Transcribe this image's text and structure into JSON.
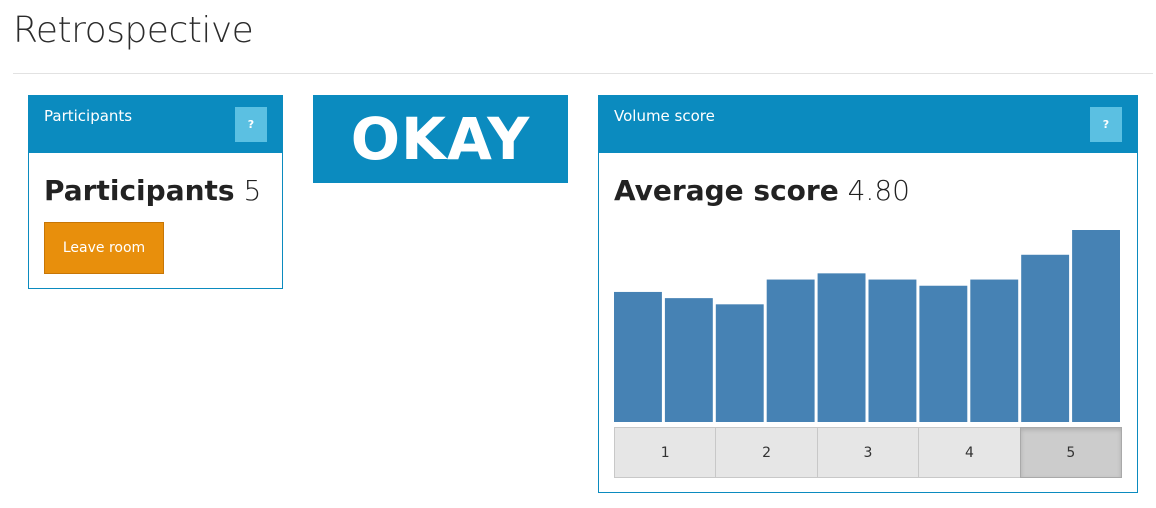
{
  "page": {
    "title": "Retrospective"
  },
  "participants_panel": {
    "title": "Participants",
    "help_label": "?",
    "count_label": "Participants",
    "count_value": "5",
    "leave_button": "Leave room"
  },
  "status_banner": "OKAY",
  "volume_panel": {
    "title": "Volume score",
    "help_label": "?",
    "average_label": "Average score",
    "average_value": "4.80",
    "score_buttons": [
      "1",
      "2",
      "3",
      "4",
      "5"
    ],
    "selected_score": "5"
  },
  "colors": {
    "accent": "#0b8bbf",
    "help_button": "#5bc0e2",
    "leave_button": "#e88f0c",
    "bar": "#4682b4"
  },
  "chart_data": {
    "type": "bar",
    "values": [
      4.2,
      4.0,
      3.8,
      4.6,
      4.8,
      4.6,
      4.4,
      4.6,
      5.4,
      6.2
    ],
    "ylim": [
      0,
      6.2
    ]
  }
}
